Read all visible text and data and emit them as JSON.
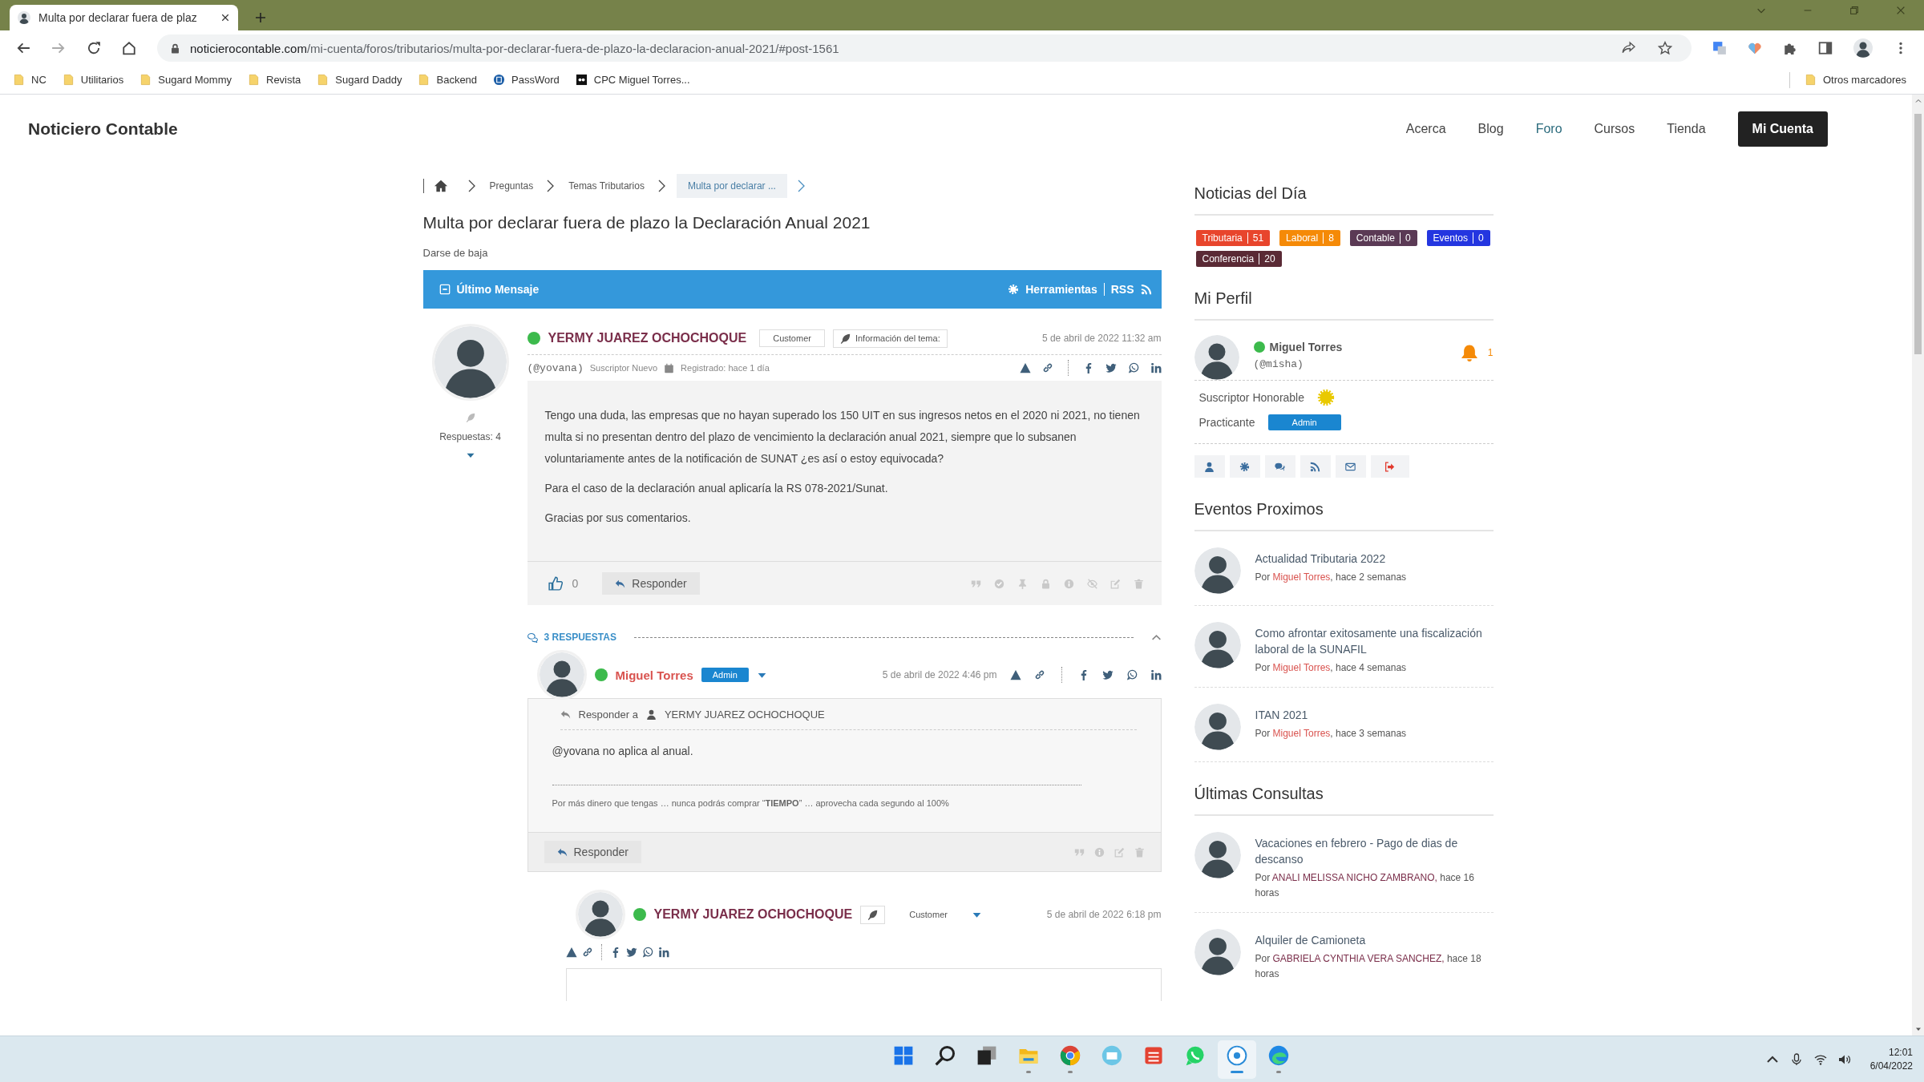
{
  "browser": {
    "tab_title": "Multa por declarar fuera de plaz",
    "url": {
      "host": "noticierocontable.com",
      "path": "/mi-cuenta/foros/tributarios/multa-por-declarar-fuera-de-plazo-la-declaracion-anual-2021/#post-1561"
    },
    "bookmarks": [
      {
        "label": "NC",
        "kind": "folder"
      },
      {
        "label": "Utilitarios",
        "kind": "folder"
      },
      {
        "label": "Sugard Mommy",
        "kind": "folder"
      },
      {
        "label": "Revista",
        "kind": "folder"
      },
      {
        "label": "Sugard Daddy",
        "kind": "folder"
      },
      {
        "label": "Backend",
        "kind": "folder"
      },
      {
        "label": "PassWord",
        "kind": "globe"
      },
      {
        "label": "CPC Miguel Torres...",
        "kind": "dark"
      }
    ],
    "other_bookmarks": "Otros marcadores"
  },
  "site": {
    "logo": "Noticiero Contable",
    "nav": [
      {
        "label": "Acerca",
        "selected": false
      },
      {
        "label": "Blog",
        "selected": false
      },
      {
        "label": "Foro",
        "selected": true
      },
      {
        "label": "Cursos",
        "selected": false
      },
      {
        "label": "Tienda",
        "selected": false
      }
    ],
    "account_button": "Mi Cuenta"
  },
  "breadcrumbs": [
    {
      "label": "Preguntas",
      "selected": false
    },
    {
      "label": "Temas Tributarios",
      "selected": false
    },
    {
      "label": "Multa por declarar ...",
      "selected": true
    }
  ],
  "topic": {
    "title": "Multa por declarar fuera de plazo la Declaración Anual 2021",
    "unsubscribe": "Darse de baja",
    "latest": "Último Mensaje",
    "tools": "Herramientas",
    "rss": "RSS"
  },
  "post": {
    "author": "YERMY JUAREZ OCHOCHOQUE",
    "online": true,
    "role": "Customer",
    "topic_info": "Información del tema:",
    "date": "5 de abril de 2022 11:32 am",
    "handle": "(@yovana)",
    "rank": "Suscriptor Nuevo",
    "registered": "Registrado: hace 1 día",
    "replies_count": "Respuestas: 4",
    "paragraphs": [
      "Tengo una duda, las empresas que no hayan superado los 150 UIT en sus ingresos netos en el 2020 ni 2021, no tienen multa si no presentan dentro del plazo de vencimiento la declaración anual 2021, siempre que lo subsanen voluntariamente antes de la notificación de SUNAT ¿es así o estoy equivocada?",
      "Para el caso de la declaración anual aplicaría la RS 078-2021/Sunat.",
      "Gracias por sus comentarios."
    ],
    "likes": "0",
    "reply_button": "Responder"
  },
  "replies": {
    "heading": "3 RESPUESTAS",
    "items": [
      {
        "kind": "admin",
        "author": "Miguel Torres",
        "online": true,
        "role": "Admin",
        "date": "5 de abril de 2022 4:46 pm",
        "reply_to_label": "Responder a",
        "reply_to": "YERMY JUAREZ OCHOCHOQUE",
        "text": "@yovana no aplica al anual.",
        "signature": "Por más dinero que tengas … nunca podrás comprar “**TIEMPO**” … aprovecha cada segundo al 100%",
        "reply_button": "Responder"
      },
      {
        "kind": "customer",
        "author": "YERMY JUAREZ OCHOCHOQUE",
        "online": true,
        "role": "Customer",
        "date": "5 de abril de 2022 6:18 pm"
      }
    ]
  },
  "sidebar": {
    "news": {
      "title": "Noticias del Día",
      "tags": [
        {
          "label": "Tributaria",
          "count": "51",
          "color": "#e8452c"
        },
        {
          "label": "Laboral",
          "count": "8",
          "color": "#f58a07"
        },
        {
          "label": "Contable",
          "count": "0",
          "color": "#5b3a55"
        },
        {
          "label": "Eventos",
          "count": "0",
          "color": "#2436e0"
        },
        {
          "label": "Conferencia",
          "count": "20",
          "color": "#5a2a35"
        }
      ]
    },
    "profile": {
      "title": "Mi Perfil",
      "name": "Miguel Torres",
      "online": true,
      "handle": "(@misha)",
      "notifications": "1",
      "rank": "Suscriptor Honorable",
      "level": "Practicante",
      "badge": "Admin",
      "actions": [
        {
          "kind": "user"
        },
        {
          "kind": "settings"
        },
        {
          "kind": "chat"
        },
        {
          "kind": "rss"
        },
        {
          "kind": "mail"
        },
        {
          "kind": "logout"
        }
      ]
    },
    "events": {
      "title": "Eventos Proximos",
      "items": [
        {
          "title": "Actualidad Tributaria 2022",
          "prefix": "Por",
          "author": "Miguel Torres",
          "suffix": ", hace 2 semanas"
        },
        {
          "title": "Como afrontar exitosamente una fiscalización laboral de la SUNAFIL",
          "prefix": "Por",
          "author": "Miguel Torres",
          "suffix": ", hace 4 semanas"
        },
        {
          "title": "ITAN 2021",
          "prefix": "Por",
          "author": "Miguel Torres",
          "suffix": ", hace 3 semanas"
        }
      ]
    },
    "consultas": {
      "title": "Últimas Consultas",
      "items": [
        {
          "title": "Vacaciones en febrero - Pago de dias de descanso",
          "prefix": "Por",
          "author": "ANALI MELISSA NICHO ZAMBRANO,",
          "time": "hace 16 horas"
        },
        {
          "title": "Alquiler de Camioneta",
          "prefix": "Por",
          "author": "GABRIELA CYNTHIA VERA SANCHEZ,",
          "time": "hace 18 horas"
        }
      ]
    }
  },
  "taskbar": {
    "apps": [
      {
        "kind": "start",
        "running": false,
        "selected": false
      },
      {
        "kind": "search",
        "running": false,
        "selected": false
      },
      {
        "kind": "taskview",
        "running": false,
        "selected": false
      },
      {
        "kind": "explorer",
        "running": true,
        "selected": false
      },
      {
        "kind": "chrome",
        "running": true,
        "selected": false
      },
      {
        "kind": "mail",
        "running": false,
        "selected": false
      },
      {
        "kind": "todo",
        "running": false,
        "selected": false
      },
      {
        "kind": "whatsapp",
        "running": false,
        "selected": false
      },
      {
        "kind": "disc",
        "running": true,
        "selected": true
      },
      {
        "kind": "edge",
        "running": true,
        "selected": false
      }
    ],
    "time": "12:01",
    "date": "6/04/2022"
  }
}
